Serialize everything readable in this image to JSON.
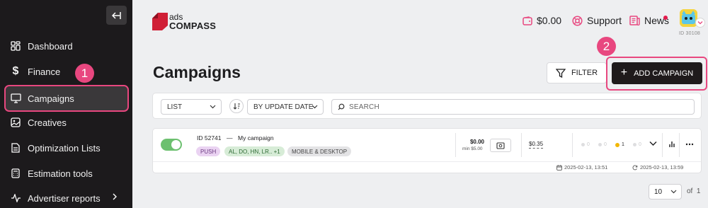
{
  "sidebar": {
    "items": [
      {
        "label": "Dashboard",
        "icon": "dashboard-icon"
      },
      {
        "label": "Finance",
        "icon": "dollar-icon"
      },
      {
        "label": "Campaigns",
        "icon": "monitor-icon"
      },
      {
        "label": "Creatives",
        "icon": "image-icon"
      },
      {
        "label": "Optimization Lists",
        "icon": "document-icon"
      },
      {
        "label": "Estimation tools",
        "icon": "calculator-icon"
      },
      {
        "label": "Advertiser reports",
        "icon": "activity-icon"
      }
    ],
    "active": "Campaigns"
  },
  "annotations": {
    "step1": "1",
    "step2": "2"
  },
  "header": {
    "logo": {
      "line1": "ads",
      "line2": "COMPASS"
    },
    "balance": "$0.00",
    "support": "Support",
    "news": "News",
    "user_id": "ID 30108"
  },
  "page": {
    "title": "Campaigns",
    "filter_label": "FILTER",
    "add_label": "ADD CAMPAIGN"
  },
  "toolbar": {
    "view": "LIST",
    "sort": "BY UPDATE DATE",
    "search_placeholder": "SEARCH"
  },
  "campaign": {
    "enabled": true,
    "id": "ID 52741",
    "separator": "—",
    "name": "My campaign",
    "tags": [
      "PUSH",
      "AL, DO, HN, LR.. +1",
      "MOBILE & DESKTOP"
    ],
    "spend": "$0.00",
    "min": "min $5.00",
    "bid": "$0.35",
    "stats": [
      "0",
      "0",
      "1",
      "0"
    ],
    "created": "2025-02-13, 13:51",
    "updated": "2025-02-13, 13:59"
  },
  "pagination": {
    "per_page": "10",
    "of_label": "of",
    "total_pages": "1"
  },
  "colors": {
    "accent": "#e8477f",
    "sidebar_bg": "#1c1a1c",
    "toggle_on": "#6cc06f"
  }
}
